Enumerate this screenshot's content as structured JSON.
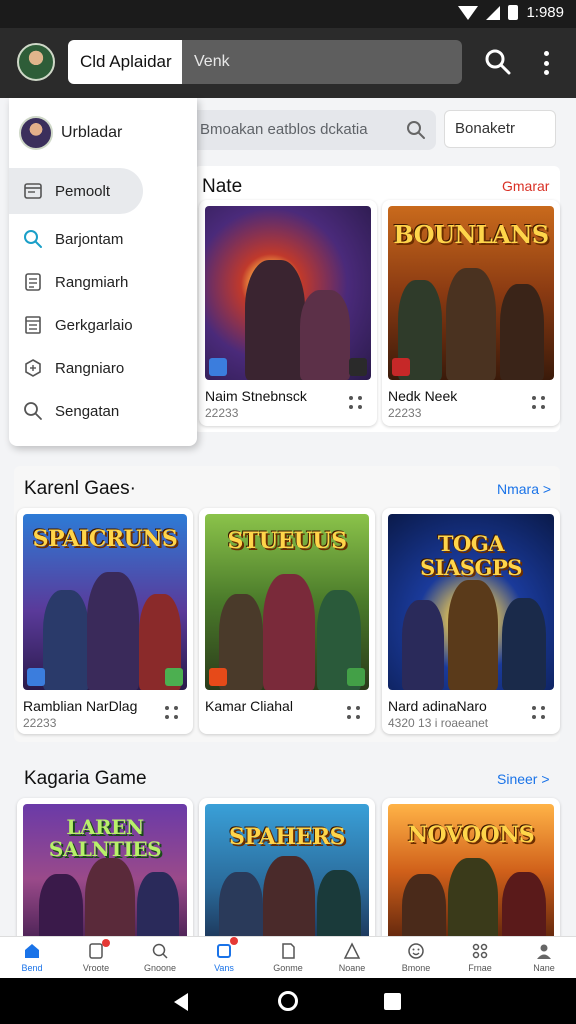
{
  "status_bar": {
    "time": "1:989"
  },
  "app_bar": {
    "title": "Cld Aplaidar",
    "search_placeholder": "Venk"
  },
  "filter": {
    "search_placeholder": "Bmoakan eatblos dckatia",
    "sort_label": "Bonaketr"
  },
  "drawer": {
    "user_name": "Urbladar",
    "items": [
      {
        "label": "Pemoolt",
        "icon": "browser-icon"
      },
      {
        "label": "Barjontam",
        "icon": "search-icon"
      },
      {
        "label": "Rangmiarh",
        "icon": "list-icon"
      },
      {
        "label": "Gerkgarlaio",
        "icon": "document-icon"
      },
      {
        "label": "Rangniaro",
        "icon": "hexagon-icon"
      },
      {
        "label": "Sengatan",
        "icon": "search-icon"
      }
    ]
  },
  "sections": [
    {
      "title": "Nate",
      "link": "Gmarar",
      "cards": [
        {
          "name": "Naim Stnebnsck",
          "meta": "22233",
          "art_title": ""
        },
        {
          "name": "Nedk Neek",
          "meta": "22233",
          "art_title": "BOUNLANS"
        }
      ]
    },
    {
      "title": "Karenl Gaes·",
      "link": "Nmara >",
      "cards": [
        {
          "name": "Ramblian NarDlag",
          "meta": "22233",
          "art_title": "SPAICRUNS"
        },
        {
          "name": "Kamar Cliahal",
          "meta": "",
          "art_title": "STUEUUS"
        },
        {
          "name": "Nard adinaNaro",
          "meta": "4320 13 i roaeanet",
          "art_title": "TOGA SIASGPS"
        }
      ]
    },
    {
      "title": "Kagaria Game",
      "link": "Sineer >",
      "cards": [
        {
          "name": "",
          "meta": "",
          "art_title": "LAREN SALNTIES"
        },
        {
          "name": "",
          "meta": "",
          "art_title": "SPAHERS"
        },
        {
          "name": "",
          "meta": "",
          "art_title": "NOVOONS"
        }
      ]
    }
  ],
  "bottom_nav": [
    {
      "label": "Bend",
      "icon": "home-icon",
      "active": true
    },
    {
      "label": "Vroote",
      "icon": "document-icon"
    },
    {
      "label": "Gnoone",
      "icon": "search-icon"
    },
    {
      "label": "Vans",
      "icon": "square-icon"
    },
    {
      "label": "Gonme",
      "icon": "document-icon"
    },
    {
      "label": "Noane",
      "icon": "triangle-icon"
    },
    {
      "label": "Bmone",
      "icon": "smile-icon"
    },
    {
      "label": "Frnae",
      "icon": "connect-icon"
    },
    {
      "label": "Nane",
      "icon": "person-icon"
    }
  ],
  "colors": {
    "accent": "#1a73e8",
    "link_red": "#d93025",
    "link_blue": "#1a73e8",
    "app_bar": "#2b2b2b",
    "notification_dot": "#e53935"
  }
}
